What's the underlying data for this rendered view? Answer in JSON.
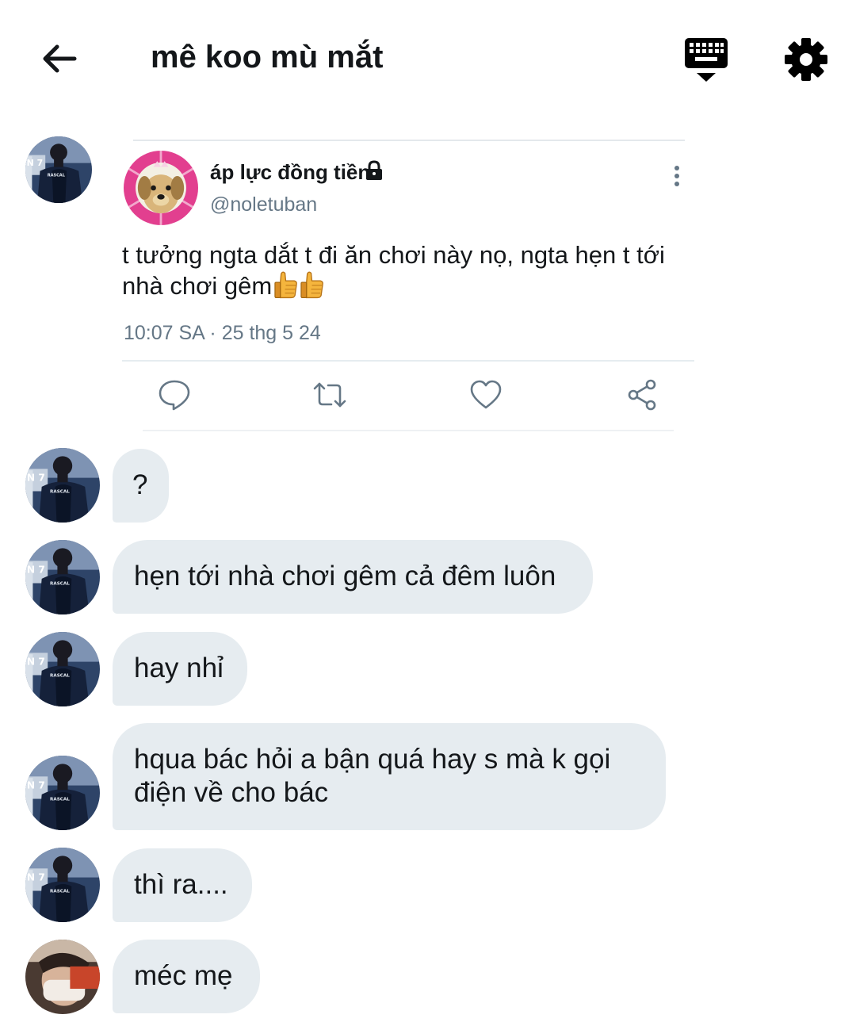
{
  "header": {
    "title": "mê koo mù mắt",
    "icons": [
      "back-arrow-icon",
      "keyboard-icon",
      "gear-icon"
    ]
  },
  "tweet": {
    "author_name": "áp lực đồng tiền",
    "author_handle": "@noletuban",
    "text": "t tưởng ngta dắt t đi ăn chơi này nọ, ngta hẹn t tới nhà chơi gêm",
    "emoji": [
      "thumbs-up",
      "thumbs-up"
    ],
    "timestamp": "10:07 SA · 25 thg 5 24",
    "actions": [
      "reply-icon",
      "retweet-icon",
      "like-icon",
      "share-icon"
    ]
  },
  "messages": [
    {
      "sender": "friend",
      "text": "?"
    },
    {
      "sender": "friend",
      "text": "hẹn tới nhà chơi gêm cả đêm luôn"
    },
    {
      "sender": "friend",
      "text": "hay nhỉ"
    },
    {
      "sender": "friend",
      "text_line1": "hqua bác hỏi a bận quá hay s mà k gọi",
      "text_line2": "điện về cho bác"
    },
    {
      "sender": "friend",
      "text": "thì ra...."
    },
    {
      "sender": "other",
      "text": "méc mẹ"
    }
  ],
  "colors": {
    "bubble_bg": "#e6ecf0",
    "text_primary": "#14171a",
    "text_secondary": "#657786",
    "icon_gray": "#657786"
  }
}
